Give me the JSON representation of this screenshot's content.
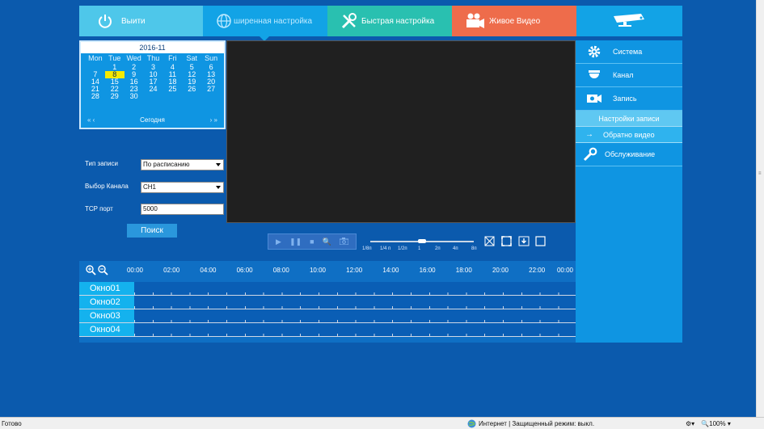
{
  "nav": {
    "exit": "Выити",
    "advanced": "ширенная настройка",
    "quick": "Быстрая настройка",
    "live": "Живое Видео"
  },
  "calendar": {
    "month": "2016-11",
    "weekdays": [
      "Mon",
      "Tue",
      "Wed",
      "Thu",
      "Fri",
      "Sat",
      "Sun"
    ],
    "weeks": [
      [
        "",
        "1",
        "2",
        "3",
        "4",
        "5",
        "6"
      ],
      [
        "7",
        "8",
        "9",
        "10",
        "11",
        "12",
        "13"
      ],
      [
        "14",
        "15",
        "16",
        "17",
        "18",
        "19",
        "20"
      ],
      [
        "21",
        "22",
        "23",
        "24",
        "25",
        "26",
        "27"
      ],
      [
        "28",
        "29",
        "30",
        "",
        "",
        "",
        ""
      ]
    ],
    "today_day": "8",
    "prev": "« ‹",
    "next": "› »",
    "today_label": "Сегодня"
  },
  "form": {
    "record_type_label": "Тип записи",
    "record_type_value": "По расписанию",
    "channel_label": "Выбор Канала",
    "channel_value": "CH1",
    "tcp_label": "TCP порт",
    "tcp_value": "5000",
    "search": "Поиск"
  },
  "player": {
    "speeds": [
      "1/8п",
      "1/4 п",
      "1/2п",
      "1",
      "2п",
      "4п",
      "8п"
    ],
    "speed_level": 0.5
  },
  "timeline": {
    "hours": [
      "00:00",
      "02:00",
      "04:00",
      "06:00",
      "08:00",
      "10:00",
      "12:00",
      "14:00",
      "16:00",
      "18:00",
      "20:00",
      "22:00",
      "00:00"
    ],
    "windows": [
      "Окно01",
      "Окно02",
      "Окно03",
      "Окно04"
    ]
  },
  "menu": {
    "system": "Система",
    "channel": "Канал",
    "record": "Запись",
    "record_settings": "Настройки записи",
    "playback": "Обратно видео",
    "maintenance": "Обслуживание"
  },
  "status": {
    "left": "Готово",
    "zone": "Интернет | Защищенный режим: выкл.",
    "zoom": "100%"
  }
}
